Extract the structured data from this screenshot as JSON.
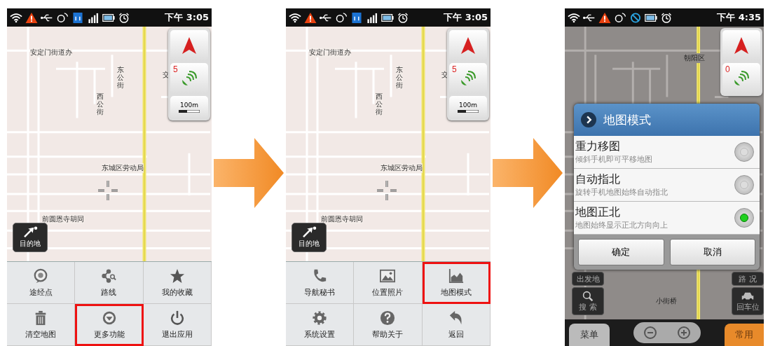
{
  "phones": [
    {
      "status_bar": {
        "icons": [
          {
            "kind": "wifi"
          },
          {
            "kind": "warning"
          },
          {
            "kind": "usb"
          },
          {
            "kind": "sync"
          },
          {
            "kind": "network"
          },
          {
            "kind": "signal"
          },
          {
            "kind": "battery"
          },
          {
            "kind": "alarm"
          }
        ],
        "time": "下午 3:05"
      },
      "map": {
        "dimmed": false,
        "labels": [
          {
            "text": "安定门街道办",
            "vertical": false
          },
          {
            "text": "东公街",
            "vertical": true
          },
          {
            "text": "西公街",
            "vertical": true
          },
          {
            "text": "交",
            "vertical": false
          },
          {
            "text": "东城区劳动局",
            "vertical": false
          },
          {
            "text": "前圆恩寺胡同",
            "vertical": false
          }
        ],
        "gps_count": "5",
        "scale": "100m",
        "destination": "目的地"
      },
      "menu": [
        {
          "label": "途经点",
          "kind": "waypoint",
          "highlighted": false
        },
        {
          "label": "路线",
          "kind": "route",
          "highlighted": false
        },
        {
          "label": "我的收藏",
          "kind": "star",
          "highlighted": false
        },
        {
          "label": "清空地图",
          "kind": "trash",
          "highlighted": false
        },
        {
          "label": "更多功能",
          "kind": "more",
          "highlighted": true
        },
        {
          "label": "退出应用",
          "kind": "power",
          "highlighted": false
        }
      ]
    },
    {
      "status_bar": {
        "icons": [
          {
            "kind": "wifi"
          },
          {
            "kind": "warning"
          },
          {
            "kind": "usb"
          },
          {
            "kind": "sync"
          },
          {
            "kind": "network"
          },
          {
            "kind": "signal"
          },
          {
            "kind": "battery"
          },
          {
            "kind": "alarm"
          }
        ],
        "time": "下午 3:05"
      },
      "map": {
        "dimmed": false,
        "labels": [
          {
            "text": "安定门街道办",
            "vertical": false
          },
          {
            "text": "东公街",
            "vertical": true
          },
          {
            "text": "西公街",
            "vertical": true
          },
          {
            "text": "交",
            "vertical": false
          },
          {
            "text": "东城区劳动局",
            "vertical": false
          },
          {
            "text": "前圆恩寺胡同",
            "vertical": false
          }
        ],
        "gps_count": "5",
        "scale": "100m",
        "destination": "目的地"
      },
      "menu": [
        {
          "label": "导航秘书",
          "kind": "phone",
          "highlighted": false
        },
        {
          "label": "位置照片",
          "kind": "photo",
          "highlighted": false
        },
        {
          "label": "地图模式",
          "kind": "chart",
          "highlighted": true
        },
        {
          "label": "系统设置",
          "kind": "gear",
          "highlighted": false
        },
        {
          "label": "帮助关于",
          "kind": "help",
          "highlighted": false
        },
        {
          "label": "返回",
          "kind": "back",
          "highlighted": false
        }
      ]
    },
    {
      "status_bar": {
        "icons": [
          {
            "kind": "wifi"
          },
          {
            "kind": "usb"
          },
          {
            "kind": "warning"
          },
          {
            "kind": "sync"
          },
          {
            "kind": "blocked"
          },
          {
            "kind": "battery"
          },
          {
            "kind": "alarm"
          }
        ],
        "time": "下午 4:35"
      },
      "map": {
        "dimmed": true,
        "labels": [
          {
            "text": "朝阳区",
            "vertical": false
          },
          {
            "text": "小街桥",
            "vertical": false
          }
        ],
        "gps_count": "0"
      },
      "side_buttons": {
        "start": "出发地",
        "search": "搜 索",
        "traffic": "路 况",
        "parking": "回车位",
        "menu": "菜单",
        "common": "常用"
      },
      "dialog": {
        "title": "地图模式",
        "options": [
          {
            "title": "重力移图",
            "description": "倾斜手机即可平移地图",
            "selected": false
          },
          {
            "title": "自动指北",
            "description": "旋转手机地图始终自动指北",
            "selected": false
          },
          {
            "title": "地图正北",
            "description": "地图始终显示正北方向向上",
            "selected": true
          }
        ],
        "buttons": [
          "确定",
          "取消"
        ]
      }
    }
  ]
}
